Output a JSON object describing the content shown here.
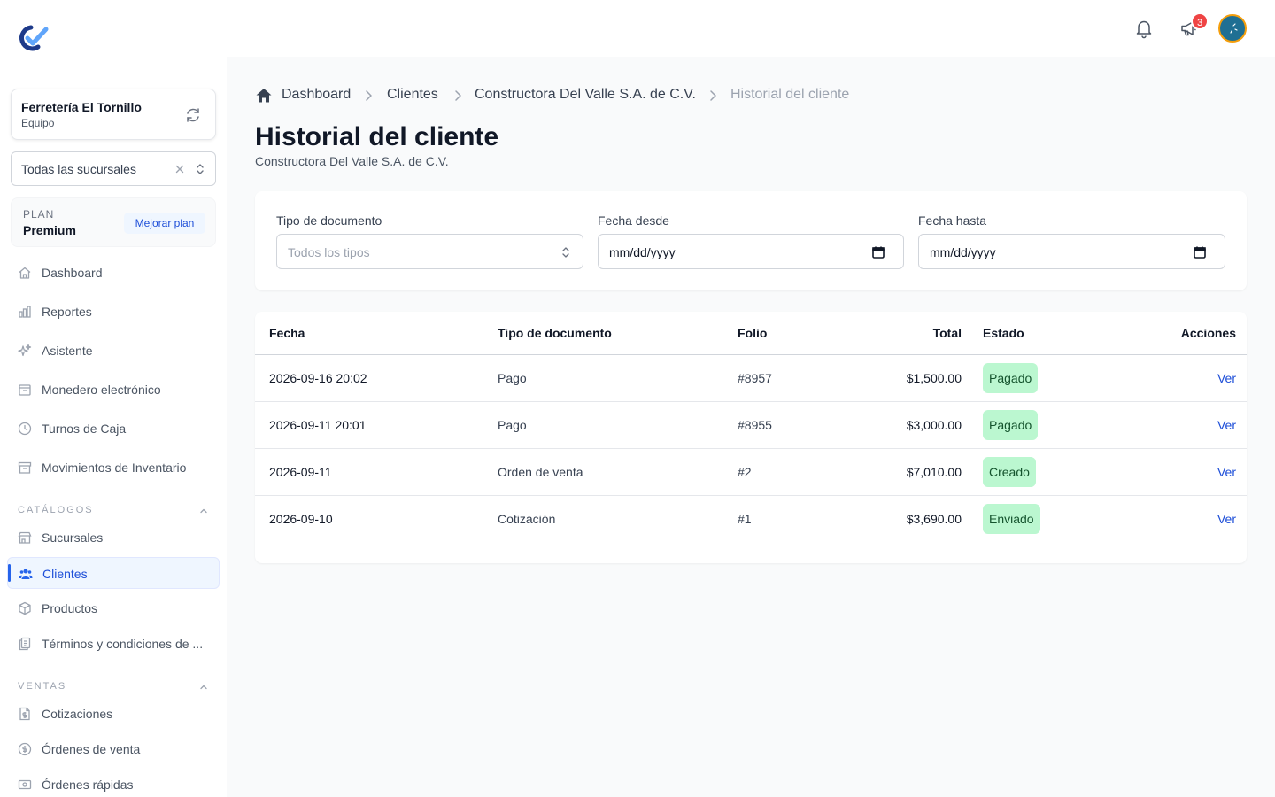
{
  "app": {
    "logo_icon": "brand-check-logo"
  },
  "org": {
    "name": "Ferretería El Tornillo",
    "role": "Equipo"
  },
  "branch_select": {
    "value": "Todas las sucursales"
  },
  "plan": {
    "label": "PLAN",
    "name": "Premium",
    "upgrade_label": "Mejorar plan"
  },
  "nav": {
    "main": [
      {
        "label": "Dashboard",
        "icon": "home-icon"
      },
      {
        "label": "Reportes",
        "icon": "bar-chart-icon"
      },
      {
        "label": "Asistente",
        "icon": "sparkles-icon"
      },
      {
        "label": "Monedero electrónico",
        "icon": "wallet-icon"
      },
      {
        "label": "Turnos de Caja",
        "icon": "clock-icon"
      },
      {
        "label": "Movimientos de Inventario",
        "icon": "archive-icon"
      }
    ],
    "catalogos": {
      "title": "CATÁLOGOS",
      "items": [
        {
          "label": "Sucursales",
          "icon": "store-icon"
        },
        {
          "label": "Clientes",
          "icon": "users-icon",
          "active": true
        },
        {
          "label": "Productos",
          "icon": "cube-icon"
        },
        {
          "label": "Términos y condiciones de ...",
          "icon": "document-copy-icon"
        }
      ]
    },
    "ventas": {
      "title": "VENTAS",
      "items": [
        {
          "label": "Cotizaciones",
          "icon": "document-dollar-icon"
        },
        {
          "label": "Órdenes de venta",
          "icon": "dollar-circle-icon"
        },
        {
          "label": "Órdenes rápidas",
          "icon": "cash-icon"
        }
      ]
    }
  },
  "topbar": {
    "notifications_badge": "3"
  },
  "breadcrumb": [
    "Dashboard",
    "Clientes",
    "Constructora Del Valle S.A. de C.V.",
    "Historial del cliente"
  ],
  "page": {
    "title": "Historial del cliente",
    "subtitle": "Constructora Del Valle S.A. de C.V."
  },
  "filters": {
    "doc_type": {
      "label": "Tipo de documento",
      "placeholder": "Todos los tipos"
    },
    "date_from": {
      "label": "Fecha desde",
      "value": "mm/dd/yyyy"
    },
    "date_to": {
      "label": "Fecha hasta",
      "value": "mm/dd/yyyy"
    }
  },
  "table": {
    "headers": [
      "Fecha",
      "Tipo de documento",
      "Folio",
      "Total",
      "Estado",
      "Acciones"
    ],
    "rows": [
      {
        "fecha": "2026-09-16 20:02",
        "tipo": "Pago",
        "folio": "#8957",
        "total": "$1,500.00",
        "estado": "Pagado",
        "accion": "Ver"
      },
      {
        "fecha": "2026-09-11 20:01",
        "tipo": "Pago",
        "folio": "#8955",
        "total": "$3,000.00",
        "estado": "Pagado",
        "accion": "Ver"
      },
      {
        "fecha": "2026-09-11",
        "tipo": "Orden de venta",
        "folio": "#2",
        "total": "$7,010.00",
        "estado": "Creado",
        "accion": "Ver"
      },
      {
        "fecha": "2026-09-10",
        "tipo": "Cotización",
        "folio": "#1",
        "total": "$3,690.00",
        "estado": "Enviado",
        "accion": "Ver"
      }
    ]
  },
  "colors": {
    "accent": "#2563eb",
    "status_bg": "#bbf7d0",
    "status_text": "#14532d",
    "badge": "#ef4444"
  }
}
